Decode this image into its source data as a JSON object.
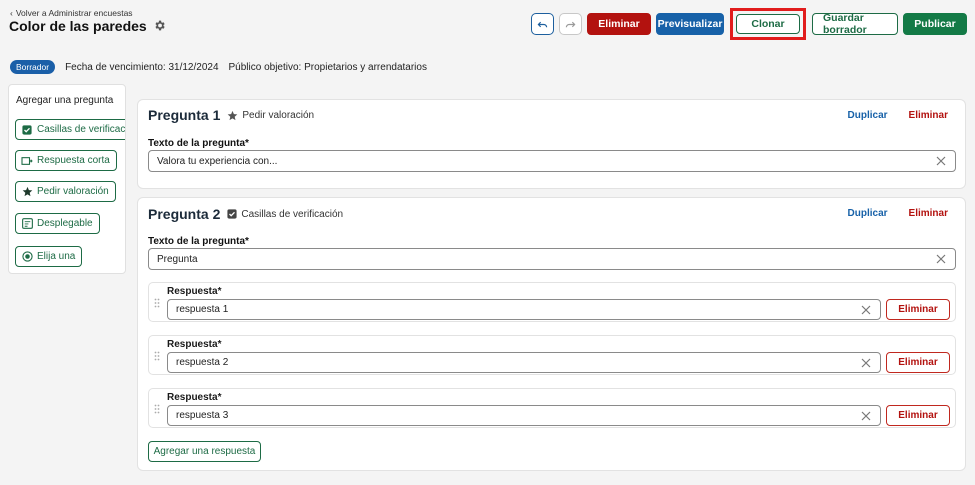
{
  "header": {
    "back_link": "Volver a Administrar encuestas",
    "title": "Color de las paredes"
  },
  "toolbar": {
    "delete_label": "Eliminar",
    "preview_label": "Previsualizar",
    "clone_label": "Clonar",
    "save_draft_label": "Guardar borrador",
    "publish_label": "Publicar"
  },
  "meta": {
    "status_badge": "Borrador",
    "due_date": "Fecha de vencimiento: 31/12/2024",
    "audience": "Público objetivo: Propietarios y arrendatarios"
  },
  "sidebar": {
    "title": "Agregar una pregunta",
    "items": [
      {
        "label": "Casillas de verificación",
        "icon": "checkbox-icon"
      },
      {
        "label": "Respuesta corta",
        "icon": "short-answer-icon"
      },
      {
        "label": "Pedir valoración",
        "icon": "star-icon"
      },
      {
        "label": "Desplegable",
        "icon": "dropdown-icon"
      },
      {
        "label": "Elija una",
        "icon": "radio-icon"
      }
    ]
  },
  "questions": [
    {
      "title": "Pregunta 1",
      "type": "Pedir valoración",
      "duplicate": "Duplicar",
      "delete": "Eliminar",
      "text_label": "Texto de la pregunta*",
      "text_value": "Valora tu experiencia con..."
    },
    {
      "title": "Pregunta 2",
      "type": "Casillas de verificación",
      "duplicate": "Duplicar",
      "delete": "Eliminar",
      "text_label": "Texto de la pregunta*",
      "text_value": "Pregunta",
      "answers": [
        {
          "label": "Respuesta*",
          "value": "respuesta 1",
          "delete": "Eliminar"
        },
        {
          "label": "Respuesta*",
          "value": "respuesta 2",
          "delete": "Eliminar"
        },
        {
          "label": "Respuesta*",
          "value": "respuesta 3",
          "delete": "Eliminar"
        }
      ],
      "add_answer": "Agregar una respuesta"
    }
  ],
  "colors": {
    "red": "#b3120f",
    "blue": "#1761a8",
    "green": "#137a46",
    "highlight": "#e11c1c"
  }
}
